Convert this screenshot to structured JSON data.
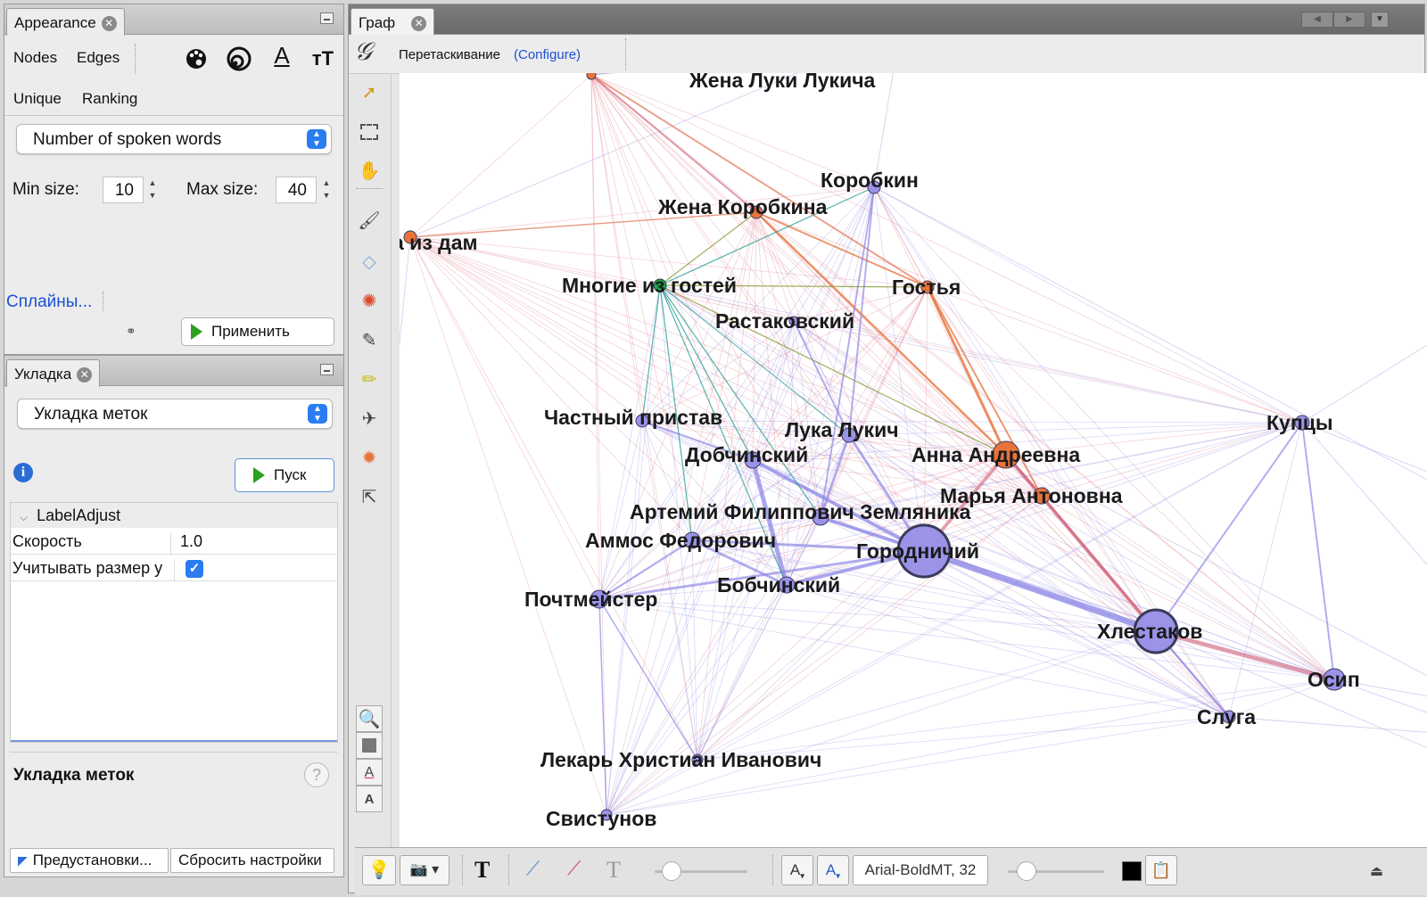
{
  "appearance": {
    "tab_label": "Appearance",
    "sub_tabs": [
      "Nodes",
      "Edges"
    ],
    "mode_tabs": [
      "Unique",
      "Ranking"
    ],
    "attribute": "Number of spoken words",
    "min_label": "Min size:",
    "min_value": "10",
    "max_label": "Max size:",
    "max_value": "40",
    "splines_link": "Сплайны...",
    "apply_button": "Применить"
  },
  "layout": {
    "tab_label": "Укладка",
    "algorithm": "Укладка меток",
    "run_button": "Пуск",
    "section_label": "LabelAdjust",
    "props": [
      {
        "name": "Скорость",
        "value": "1.0"
      },
      {
        "name": "Учитывать размер у",
        "value": ""
      }
    ],
    "checkbox_checked": true,
    "description_title": "Укладка меток",
    "presets_button": "Предустановки...",
    "reset_button": "Сбросить настройки"
  },
  "graph": {
    "tab_label": "Граф",
    "tool_label": "Перетаскивание",
    "configure_link": "(Configure)",
    "nodes": [
      {
        "id": "zhena_luki",
        "label": "Жена Луки Лукича",
        "color": "#e8743b",
        "size": 5
      },
      {
        "id": "odna_iz_dam",
        "label": "а из дам",
        "color": "#e8743b",
        "size": 7
      },
      {
        "id": "zhena_korobkina",
        "label": "Жена Коробкина",
        "color": "#e8743b",
        "size": 7
      },
      {
        "id": "korobkin",
        "label": "Коробкин",
        "color": "#9a93e8",
        "size": 7
      },
      {
        "id": "mnogie",
        "label": "Многие из гостей",
        "color": "#1e9e4a",
        "size": 7
      },
      {
        "id": "gostya",
        "label": "Гостья",
        "color": "#e8743b",
        "size": 7
      },
      {
        "id": "rastakovsky",
        "label": "Растаковский",
        "color": "#9a93e8",
        "size": 5
      },
      {
        "id": "chastny",
        "label": "Частный пристав",
        "color": "#9a93e8",
        "size": 7
      },
      {
        "id": "luka",
        "label": "Лука Лукич",
        "color": "#9a93e8",
        "size": 8
      },
      {
        "id": "dobchinsky",
        "label": "Добчинский",
        "color": "#9a93e8",
        "size": 9
      },
      {
        "id": "anna",
        "label": "Анна Андреевна",
        "color": "#e8743b",
        "size": 15
      },
      {
        "id": "marya",
        "label": "Марья Антоновна",
        "color": "#e8743b",
        "size": 9
      },
      {
        "id": "artemy",
        "label": "Артемий Филиппович Земляника",
        "color": "#9a93e8",
        "size": 9
      },
      {
        "id": "ammos",
        "label": "Аммос Федорович",
        "color": "#9a93e8",
        "size": 9
      },
      {
        "id": "gorodnichy",
        "label": "Городничий",
        "color": "#9a93e8",
        "size": 29
      },
      {
        "id": "bobchinsky",
        "label": "Бобчинский",
        "color": "#9a93e8",
        "size": 9
      },
      {
        "id": "pochtmeister",
        "label": "Почтмейстер",
        "color": "#9a93e8",
        "size": 10
      },
      {
        "id": "khlestakov",
        "label": "Хлестаков",
        "color": "#9a93e8",
        "size": 24
      },
      {
        "id": "kuptsy",
        "label": "Купцы",
        "color": "#9a93e8",
        "size": 8
      },
      {
        "id": "osip",
        "label": "Осип",
        "color": "#9a93e8",
        "size": 12
      },
      {
        "id": "sluga",
        "label": "Слуга",
        "color": "#9a93e8",
        "size": 7
      },
      {
        "id": "lekar",
        "label": "Лекарь Христиан Иванович",
        "color": "#9a93e8",
        "size": 6
      },
      {
        "id": "svistunov",
        "label": "Свистунов",
        "color": "#9a93e8",
        "size": 6
      }
    ]
  },
  "toolbar": {
    "font_value": "Arial-BoldMT, 32"
  }
}
